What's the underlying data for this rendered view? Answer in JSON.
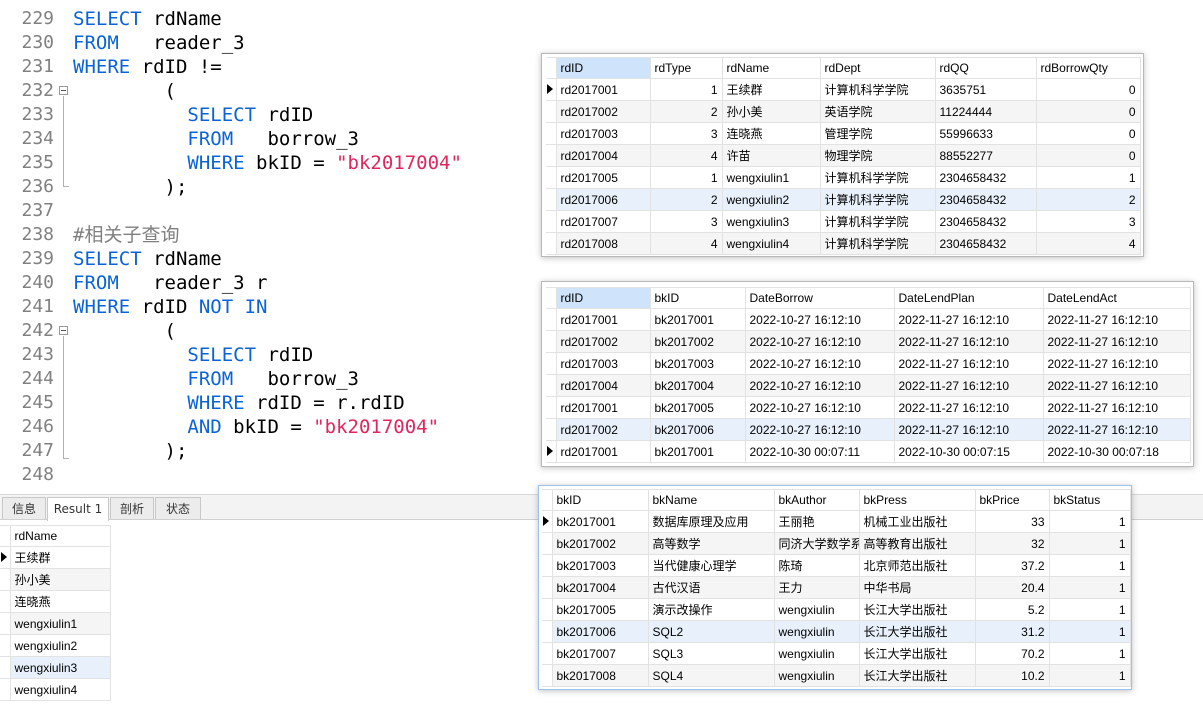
{
  "editor": {
    "lines": [
      {
        "n": "229",
        "toks": [
          {
            "t": "SELECT",
            "c": "kw"
          },
          {
            "t": " rdName",
            "c": ""
          }
        ]
      },
      {
        "n": "230",
        "toks": [
          {
            "t": "FROM",
            "c": "kw"
          },
          {
            "t": "   reader_3",
            "c": ""
          }
        ]
      },
      {
        "n": "231",
        "toks": [
          {
            "t": "WHERE",
            "c": "kw"
          },
          {
            "t": " rdID !=",
            "c": ""
          }
        ]
      },
      {
        "n": "232",
        "toks": [
          {
            "t": "        (",
            "c": ""
          }
        ]
      },
      {
        "n": "233",
        "toks": [
          {
            "t": "          ",
            "c": ""
          },
          {
            "t": "SELECT",
            "c": "kw"
          },
          {
            "t": " rdID",
            "c": ""
          }
        ]
      },
      {
        "n": "234",
        "toks": [
          {
            "t": "          ",
            "c": ""
          },
          {
            "t": "FROM",
            "c": "kw"
          },
          {
            "t": "   borrow_3",
            "c": ""
          }
        ]
      },
      {
        "n": "235",
        "toks": [
          {
            "t": "          ",
            "c": ""
          },
          {
            "t": "WHERE",
            "c": "kw"
          },
          {
            "t": " bkID = ",
            "c": ""
          },
          {
            "t": "\"bk2017004\"",
            "c": "str"
          }
        ]
      },
      {
        "n": "236",
        "toks": [
          {
            "t": "        );",
            "c": ""
          }
        ]
      },
      {
        "n": "237",
        "toks": []
      },
      {
        "n": "238",
        "toks": [
          {
            "t": "#相关子查询",
            "c": "cmt"
          }
        ]
      },
      {
        "n": "239",
        "toks": [
          {
            "t": "SELECT",
            "c": "kw"
          },
          {
            "t": " rdName",
            "c": ""
          }
        ]
      },
      {
        "n": "240",
        "toks": [
          {
            "t": "FROM",
            "c": "kw"
          },
          {
            "t": "   reader_3 r",
            "c": ""
          }
        ]
      },
      {
        "n": "241",
        "toks": [
          {
            "t": "WHERE",
            "c": "kw"
          },
          {
            "t": " rdID ",
            "c": ""
          },
          {
            "t": "NOT IN",
            "c": "kw"
          }
        ]
      },
      {
        "n": "242",
        "toks": [
          {
            "t": "        (",
            "c": ""
          }
        ]
      },
      {
        "n": "243",
        "toks": [
          {
            "t": "          ",
            "c": ""
          },
          {
            "t": "SELECT",
            "c": "kw"
          },
          {
            "t": " rdID",
            "c": ""
          }
        ]
      },
      {
        "n": "244",
        "toks": [
          {
            "t": "          ",
            "c": ""
          },
          {
            "t": "FROM",
            "c": "kw"
          },
          {
            "t": "   borrow_3",
            "c": ""
          }
        ]
      },
      {
        "n": "245",
        "toks": [
          {
            "t": "          ",
            "c": ""
          },
          {
            "t": "WHERE",
            "c": "kw"
          },
          {
            "t": " rdID = r.rdID",
            "c": ""
          }
        ]
      },
      {
        "n": "246",
        "toks": [
          {
            "t": "          ",
            "c": ""
          },
          {
            "t": "AND",
            "c": "kw"
          },
          {
            "t": " bkID = ",
            "c": ""
          },
          {
            "t": "\"bk2017004\"",
            "c": "str"
          }
        ]
      },
      {
        "n": "247",
        "toks": [
          {
            "t": "        );",
            "c": ""
          }
        ]
      },
      {
        "n": "248",
        "toks": []
      }
    ]
  },
  "tabs": [
    "信息",
    "Result 1",
    "剖析",
    "状态"
  ],
  "result": {
    "columns": [
      "rdName"
    ],
    "rows": [
      [
        "王续群"
      ],
      [
        "孙小美"
      ],
      [
        "连晓燕"
      ],
      [
        "wengxiulin1"
      ],
      [
        "wengxiulin2"
      ],
      [
        "wengxiulin3"
      ],
      [
        "wengxiulin4"
      ]
    ]
  },
  "reader_grid": {
    "columns": [
      "rdID",
      "rdType",
      "rdName",
      "rdDept",
      "rdQQ",
      "rdBorrowQty"
    ],
    "rows": [
      [
        "rd2017001",
        "1",
        "王续群",
        "计算机科学学院",
        "3635751",
        "0"
      ],
      [
        "rd2017002",
        "2",
        "孙小美",
        "英语学院",
        "11224444",
        "0"
      ],
      [
        "rd2017003",
        "3",
        "连晓燕",
        "管理学院",
        "55996633",
        "0"
      ],
      [
        "rd2017004",
        "4",
        "许苗",
        "物理学院",
        "88552277",
        "0"
      ],
      [
        "rd2017005",
        "1",
        "wengxiulin1",
        "计算机科学学院",
        "2304658432",
        "1"
      ],
      [
        "rd2017006",
        "2",
        "wengxiulin2",
        "计算机科学学院",
        "2304658432",
        "2"
      ],
      [
        "rd2017007",
        "3",
        "wengxiulin3",
        "计算机科学学院",
        "2304658432",
        "3"
      ],
      [
        "rd2017008",
        "4",
        "wengxiulin4",
        "计算机科学学院",
        "2304658432",
        "4"
      ]
    ]
  },
  "borrow_grid": {
    "columns": [
      "rdID",
      "bkID",
      "DateBorrow",
      "DateLendPlan",
      "DateLendAct"
    ],
    "rows": [
      [
        "rd2017001",
        "bk2017001",
        "2022-10-27 16:12:10",
        "2022-11-27 16:12:10",
        "2022-11-27 16:12:10"
      ],
      [
        "rd2017002",
        "bk2017002",
        "2022-10-27 16:12:10",
        "2022-11-27 16:12:10",
        "2022-11-27 16:12:10"
      ],
      [
        "rd2017003",
        "bk2017003",
        "2022-10-27 16:12:10",
        "2022-11-27 16:12:10",
        "2022-11-27 16:12:10"
      ],
      [
        "rd2017004",
        "bk2017004",
        "2022-10-27 16:12:10",
        "2022-11-27 16:12:10",
        "2022-11-27 16:12:10"
      ],
      [
        "rd2017001",
        "bk2017005",
        "2022-10-27 16:12:10",
        "2022-11-27 16:12:10",
        "2022-11-27 16:12:10"
      ],
      [
        "rd2017002",
        "bk2017006",
        "2022-10-27 16:12:10",
        "2022-11-27 16:12:10",
        "2022-11-27 16:12:10"
      ],
      [
        "rd2017001",
        "bk2017001",
        "2022-10-30 00:07:11",
        "2022-10-30 00:07:15",
        "2022-10-30 00:07:18"
      ]
    ]
  },
  "book_grid": {
    "columns": [
      "bkID",
      "bkName",
      "bkAuthor",
      "bkPress",
      "bkPrice",
      "bkStatus"
    ],
    "rows": [
      [
        "bk2017001",
        "数据库原理及应用",
        "王丽艳",
        "机械工业出版社",
        "33",
        "1"
      ],
      [
        "bk2017002",
        "高等数学",
        "同济大学数学系",
        "高等教育出版社",
        "32",
        "1"
      ],
      [
        "bk2017003",
        "当代健康心理学",
        "陈琦",
        "北京师范出版社",
        "37.2",
        "1"
      ],
      [
        "bk2017004",
        "古代汉语",
        "王力",
        "中华书局",
        "20.4",
        "1"
      ],
      [
        "bk2017005",
        "演示改操作",
        "wengxiulin",
        "长江大学出版社",
        "5.2",
        "1"
      ],
      [
        "bk2017006",
        "SQL2",
        "wengxiulin",
        "长江大学出版社",
        "31.2",
        "1"
      ],
      [
        "bk2017007",
        "SQL3",
        "wengxiulin",
        "长江大学出版社",
        "70.2",
        "1"
      ],
      [
        "bk2017008",
        "SQL4",
        "wengxiulin",
        "长江大学出版社",
        "10.2",
        "1"
      ]
    ]
  }
}
